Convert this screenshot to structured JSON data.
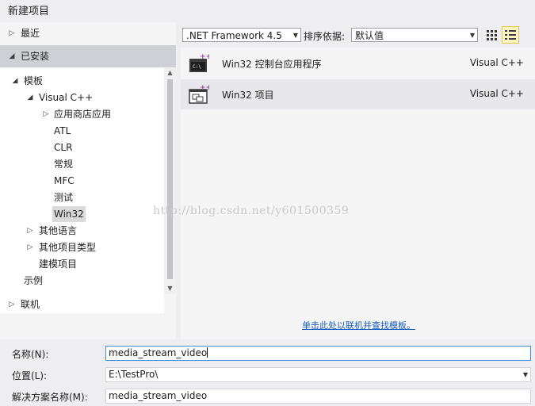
{
  "window": {
    "title": "新建项目"
  },
  "tree": {
    "recent": "最近",
    "installed": "已安装",
    "templates": "模板",
    "visual_cpp": "Visual C++",
    "children": [
      "应用商店应用",
      "ATL",
      "CLR",
      "常规",
      "MFC",
      "测试",
      "Win32"
    ],
    "other_languages": "其他语言",
    "other_project_types": "其他项目类型",
    "modeling_projects": "建模项目",
    "samples": "示例",
    "online": "联机"
  },
  "toolbar": {
    "framework": ".NET Framework 4.5",
    "sort_label": "排序依据:",
    "sort_value": "默认值"
  },
  "templates": [
    {
      "name": "Win32 控制台应用程序",
      "language": "Visual C++",
      "icon": "console-app-icon"
    },
    {
      "name": "Win32 项目",
      "language": "Visual C++",
      "icon": "win32-project-icon"
    }
  ],
  "online_link": "单击此处以联机并查找模板。",
  "watermark": "http://blog.csdn.net/y601500359",
  "form": {
    "name_label": "名称(N):",
    "name_value": "media_stream_video",
    "location_label": "位置(L):",
    "location_value": "E:\\TestPro\\",
    "solution_label": "解决方案名称(M):",
    "solution_value": "media_stream_video"
  }
}
